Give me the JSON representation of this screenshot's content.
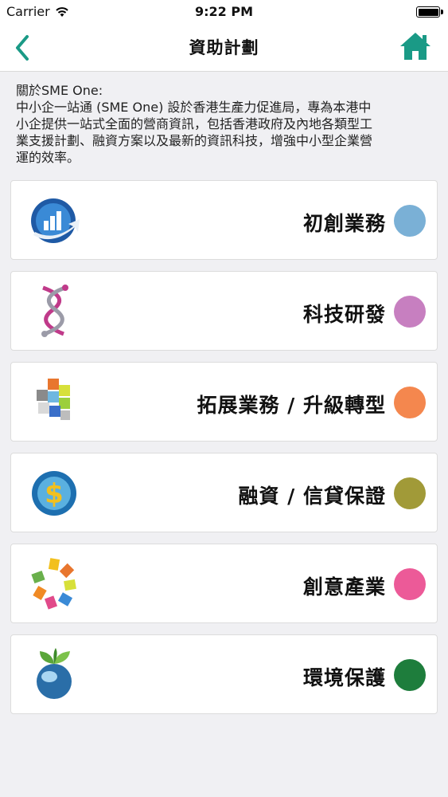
{
  "status_bar": {
    "carrier": "Carrier",
    "time": "9:22 PM"
  },
  "nav": {
    "title": "資助計劃"
  },
  "about": {
    "lines": [
      "關於SME One:",
      "中小企一站通 (SME One) 設於香港生產力促進局，專為本港中",
      "小企提供一站式全面的營商資訊，包括香港政府及內地各類型工",
      "業支援計劃、融資方案以及最新的資訊科技，增強中小型企業營",
      "運的效率。"
    ]
  },
  "categories": [
    {
      "label": "初創業務",
      "color": "#7ab0d6",
      "icon": "startup-globe-chart-icon"
    },
    {
      "label": "科技研發",
      "color": "#c77fc0",
      "icon": "tech-dna-helix-icon"
    },
    {
      "label": "拓展業務 / 升級轉型",
      "color": "#f4874e",
      "icon": "expansion-cubes-icon"
    },
    {
      "label": "融資 / 信貸保證",
      "color": "#a19a38",
      "icon": "finance-dollar-globe-icon"
    },
    {
      "label": "創意產業",
      "color": "#ec5a98",
      "icon": "creative-color-ring-icon"
    },
    {
      "label": "環境保護",
      "color": "#1e7d3c",
      "icon": "environment-globe-leaves-icon"
    }
  ]
}
